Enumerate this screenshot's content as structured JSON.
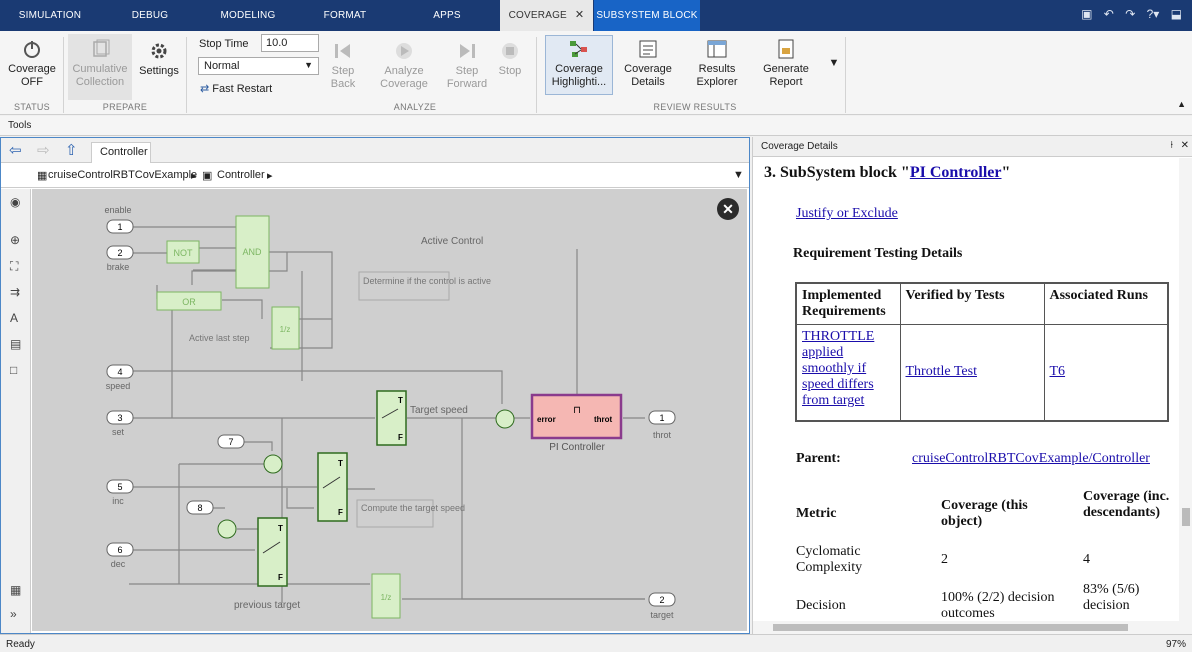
{
  "tabs": [
    {
      "label": "SIMULATION",
      "active": false
    },
    {
      "label": "DEBUG",
      "active": false
    },
    {
      "label": "MODELING",
      "active": false
    },
    {
      "label": "FORMAT",
      "active": false
    },
    {
      "label": "APPS",
      "active": false
    },
    {
      "label": "COVERAGE",
      "active": true
    },
    {
      "label": "SUBSYSTEM BLOCK",
      "active": false
    }
  ],
  "ribbon": {
    "coverage_off": "Coverage OFF",
    "cumulative": "Cumulative Collection",
    "settings": "Settings",
    "stop_time_label": "Stop Time",
    "stop_time_value": "10.0",
    "sim_mode": "Normal",
    "fast_restart": "Fast Restart",
    "step_back": "Step Back",
    "analyze_coverage": "Analyze Coverage",
    "step_forward": "Step Forward",
    "stop": "Stop",
    "coverage_highlight": "Coverage Highlighti...",
    "coverage_details": "Coverage Details",
    "results_explorer": "Results Explorer",
    "generate_report": "Generate Report",
    "groups": {
      "status": "STATUS",
      "prepare": "PREPARE",
      "analyze": "ANALYZE",
      "review": "REVIEW RESULTS"
    }
  },
  "tools_label": "Tools",
  "editor": {
    "tab": "Controller",
    "crumb1": "cruiseControlRBTCovExample",
    "crumb2": "Controller"
  },
  "diagram": {
    "ports_in": [
      {
        "num": "1",
        "name": "enable"
      },
      {
        "num": "2",
        "name": "brake"
      },
      {
        "num": "4",
        "name": "speed"
      },
      {
        "num": "3",
        "name": "set"
      },
      {
        "num": "5",
        "name": "inc"
      },
      {
        "num": "6",
        "name": "dec"
      }
    ],
    "consts": [
      "7",
      "8"
    ],
    "ports_out": [
      {
        "num": "1",
        "name": "throt"
      },
      {
        "num": "2",
        "name": "target"
      }
    ],
    "blocks": {
      "not": "NOT",
      "and": "AND",
      "or": "OR",
      "unit_delay": "1/z",
      "pi_name": "PI Controller",
      "pi_in": "error",
      "pi_out": "throt",
      "switch_t": "T",
      "switch_f": "F"
    },
    "labels": {
      "active_control": "Active Control",
      "determine": "Determine if the control is active",
      "active_last": "Active last step",
      "target_speed": "Target speed",
      "compute": "Compute the target speed",
      "previous_target": "previous target"
    }
  },
  "coverage_pane": {
    "title": "Coverage Details",
    "heading_prefix": "3. SubSystem block \"",
    "heading_link": "PI Controller",
    "heading_suffix": "\"",
    "justify": "Justify or Exclude",
    "req_title": "Requirement Testing Details",
    "req_headers": [
      "Implemented Requirements",
      "Verified by Tests",
      "Associated Runs"
    ],
    "req_rows": [
      {
        "req": "THROTTLE applied smoothly if speed differs from target",
        "test": "Throttle Test",
        "run": "T6"
      }
    ],
    "parent_label": "Parent:",
    "parent_link": "cruiseControlRBTCovExample/Controller",
    "metric_headers": [
      "Metric",
      "Coverage (this object)",
      "Coverage (inc. descendants)"
    ],
    "metrics": [
      {
        "name": "Cyclomatic Complexity",
        "this": "2",
        "inc": "4"
      },
      {
        "name": "Decision",
        "this": "100% (2/2) decision outcomes",
        "inc": "83% (5/6) decision"
      }
    ]
  },
  "status": {
    "left": "Ready",
    "right": "97%"
  }
}
